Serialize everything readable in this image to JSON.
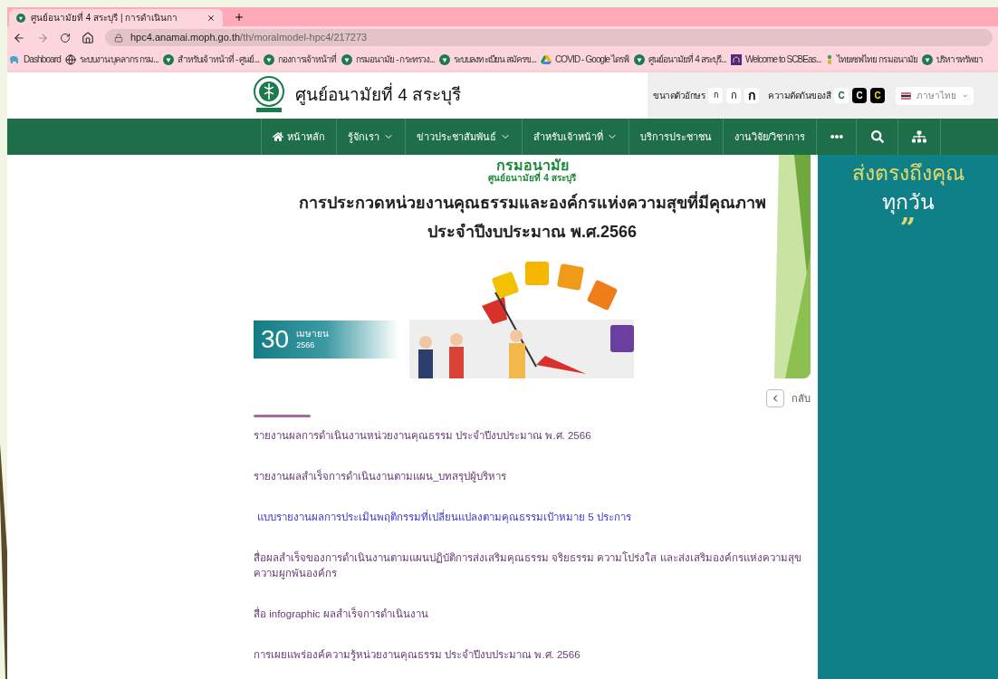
{
  "browser": {
    "tab": {
      "title": "ศูนย์อนามัยที่ 4 สระบุรี | การดำเนินกา",
      "selected": true
    },
    "url": {
      "domain": "hpc4.anamai.moph.go.th",
      "path": "/th/moralmodel-hpc4/217273"
    },
    "bookmarks": [
      {
        "kind": "elephant",
        "label": "Dashboard"
      },
      {
        "kind": "globe",
        "label": "ระบบงานบุคลากร กรม..."
      },
      {
        "kind": "anamai",
        "label": "สำหรับเจ้าหน้าที่ - ศูนย์..."
      },
      {
        "kind": "anamai",
        "label": "กองการเจ้าหน้าที่"
      },
      {
        "kind": "anamai",
        "label": "กรมอนามัย - กระทรวง..."
      },
      {
        "kind": "anamai",
        "label": "ระบบลงทะเบียน สมัครข..."
      },
      {
        "kind": "drive",
        "label": "COVID - Google ไดรฟ์"
      },
      {
        "kind": "anamai",
        "label": "ศูนย์อนามัยที่ 4 สระบุรี..."
      },
      {
        "kind": "scb",
        "label": "Welcome to SCBEas..."
      },
      {
        "kind": "thai",
        "label": "ไทยเซฟไทย กรมอนามัย"
      },
      {
        "kind": "anamai",
        "label": "บริหารทรัพยา"
      }
    ]
  },
  "header": {
    "site_title": "ศูนย์อนามัยที่ 4 สระบุรี",
    "font_size_label": "ขนาดตัวอักษร",
    "font_size_buttons": [
      {
        "label": "ก",
        "kind": "small"
      },
      {
        "label": "ก",
        "kind": "medium"
      },
      {
        "label": "ก",
        "kind": "large"
      }
    ],
    "contrast_label": "ความตัดกันของสี",
    "contrast_buttons": [
      {
        "label": "C",
        "kind": "normal"
      },
      {
        "label": "C",
        "kind": "dark"
      },
      {
        "label": "C",
        "kind": "yellow"
      }
    ],
    "language": "ภาษาไทย"
  },
  "nav": [
    {
      "kind": "home",
      "label": "หน้าหลัก"
    },
    {
      "kind": "dropdown",
      "label": "รู้จักเรา"
    },
    {
      "kind": "dropdown",
      "label": "ข่าวประชาสัมพันธ์"
    },
    {
      "kind": "dropdown",
      "label": "สำหรับเจ้าหน้าที่"
    },
    {
      "kind": "link",
      "label": "บริการประชาชน"
    },
    {
      "kind": "link",
      "label": "งานวิจัย/วิชาการ"
    },
    {
      "kind": "more"
    },
    {
      "kind": "search"
    },
    {
      "kind": "sitemap"
    }
  ],
  "banner": {
    "org": "กรมอนามัย",
    "org_sub": "ศูนย์อนามัยที่ 4 สระบุรี",
    "headline": [
      "การประกวดหน่วยงานคุณธรรมและองค์กรแห่งความสุขที่มีคุณภาพ",
      "ประจำปีงบประมาณ พ.ศ.2566"
    ],
    "date": {
      "day": "30",
      "month": "เมษายน",
      "year": "2566"
    }
  },
  "back_label": "กลับ",
  "links": [
    {
      "text": "รายงานผลการดำเนินงานหน่วยงานคุณธรรม ประจำปีงบประมาณ พ.ศ. 2566",
      "visited": true
    },
    {
      "text": "รายงานผลสำเร็จการดำเนินงานตามแผน_บทสรุปผู้บริหาร",
      "visited": true
    },
    {
      "text": "แบบรายงานผลการประเมินพฤติกรรมที่เปลี่ยนแปลงตามคุณธรรมเป้าหมาย 5 ประการ",
      "visited": false
    },
    {
      "text": "สื่อผลสำเร็จของการดำเนินงานตามแผนปฏิบัติการส่งเสริมคุณธรรม จริยธรรม ความโปร่งใส และส่งเสริมองค์กรแห่งความสุขความผูกพันองค์กร",
      "visited": true
    },
    {
      "text": "สื่อ infographic ผลสำเร็จการดำเนินงาน",
      "visited": true
    },
    {
      "text": "การเผยแพร่องค์ความรู้หน่วยงานคุณธรรม ประจำปีงบประมาณ พ.ศ. 2566",
      "visited": true
    }
  ],
  "sidebar": {
    "line_1": "ส่งตรงถึงคุณ",
    "line_2": "ทุกวัน",
    "quote": "”"
  }
}
